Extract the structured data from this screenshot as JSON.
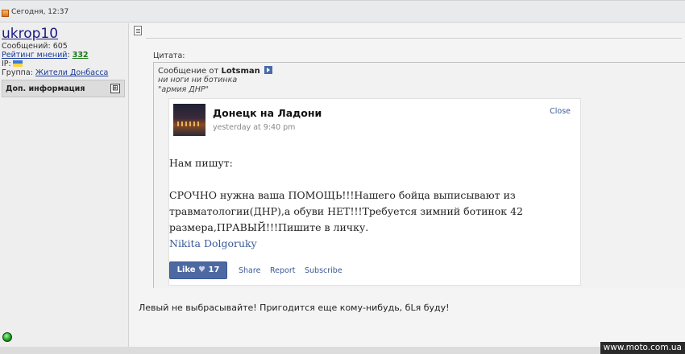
{
  "post": {
    "timestamp": "Сегодня, 12:37"
  },
  "user": {
    "name": "ukrop10",
    "messages_label": "Сообщений:",
    "messages_count": "605",
    "rating_label": "Рейтинг мнений",
    "rating_value": "332",
    "ip_label": "IP:",
    "group_label": "Группа:",
    "group_value": "Жители Донбасса",
    "more_info": "Доп. информация",
    "more_info_icon": "expand-box-icon"
  },
  "quote": {
    "label": "Цитата:",
    "from_prefix": "Сообщение от",
    "author": "Lotsman",
    "line1": "ни ноги ни ботинка",
    "line2": "\"армия ДНР\""
  },
  "fb": {
    "page_name": "Донецк на Ладони",
    "time": "yesterday at 9:40 pm",
    "close": "Close",
    "p1": "Нам пишут:",
    "p2a": "СРОЧНО нужна ваша ПОМОЩЬ!!!Нашего бойца выписывают из",
    "p2b": "травматологии(ДНР),а обуви НЕТ!!!Требуется зимний ботинок 42",
    "p2c": "размера,ПРАВЫЙ!!!Пишите в личку.",
    "author": "Nikita Dolgoruky",
    "like_label": "Like",
    "like_count": "17",
    "share": "Share",
    "report": "Report",
    "subscribe": "Subscribe"
  },
  "reply_text": "Левый не выбрасывайте! Пригодится еще кому-нибудь, бLя буду!",
  "watermark": "www.moto.com.ua",
  "colors": {
    "fb_blue": "#3b5998",
    "rating_green": "#1a7a1a",
    "username_blue": "#1a1a80"
  }
}
